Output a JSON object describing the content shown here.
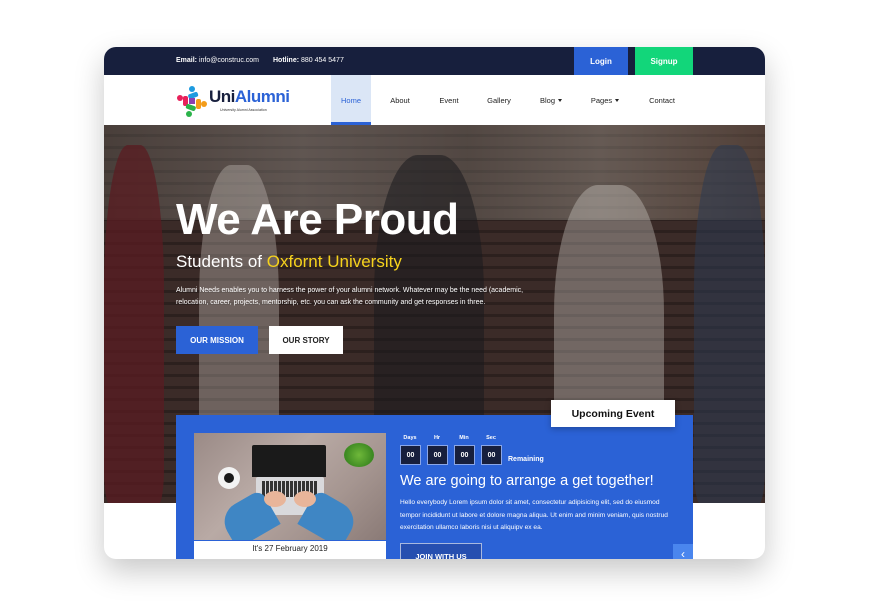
{
  "topbar": {
    "email_label": "Email:",
    "email_value": "info@construc.com",
    "hotline_label": "Hotline:",
    "hotline_value": "880 454 5477",
    "login_label": "Login",
    "signup_label": "Signup"
  },
  "logo": {
    "name_part1": "Uni",
    "name_part2": "Alumni",
    "tagline": "University Alumni Association"
  },
  "nav": {
    "items": [
      {
        "label": "Home",
        "active": true
      },
      {
        "label": "About"
      },
      {
        "label": "Event"
      },
      {
        "label": "Gallery"
      },
      {
        "label": "Blog",
        "dropdown": true
      },
      {
        "label": "Pages",
        "dropdown": true
      },
      {
        "label": "Contact"
      }
    ]
  },
  "hero": {
    "title": "We Are Proud",
    "subtitle_prefix": "Students of",
    "subtitle_highlight": "Oxfornt University",
    "description": "Alumni Needs enables you to harness the power of your alumni network. Whatever may be the need (academic, relocation, career, projects, mentorship, etc. you can ask the community and get responses in three.",
    "primary_button": "OUR MISSION",
    "secondary_button": "OUR STORY"
  },
  "event": {
    "badge": "Upcoming Event",
    "date": "It's 27 February 2019",
    "countdown": [
      {
        "label": "Days",
        "value": "00"
      },
      {
        "label": "Hr",
        "value": "00"
      },
      {
        "label": "Min",
        "value": "00"
      },
      {
        "label": "Sec",
        "value": "00"
      }
    ],
    "remaining_label": "Remaining",
    "title": "We are going to arrange a get together!",
    "description": "Hello everybody Lorem ipsum dolor sit amet, consectetur adipisicing elit, sed do eiusmod tempor incididunt ut labore et dolore magna aliqua. Ut enim and minim veniam, quis nostrud exercitation ullamco laboris nisi ut aliquipv ex ea.",
    "join_button": "JOIN WITH US",
    "prev_icon": "‹"
  },
  "colors": {
    "navy": "#171f3d",
    "primary_blue": "#2b62d6",
    "signup_green": "#12d67a",
    "highlight_yellow": "#f5d21c"
  }
}
